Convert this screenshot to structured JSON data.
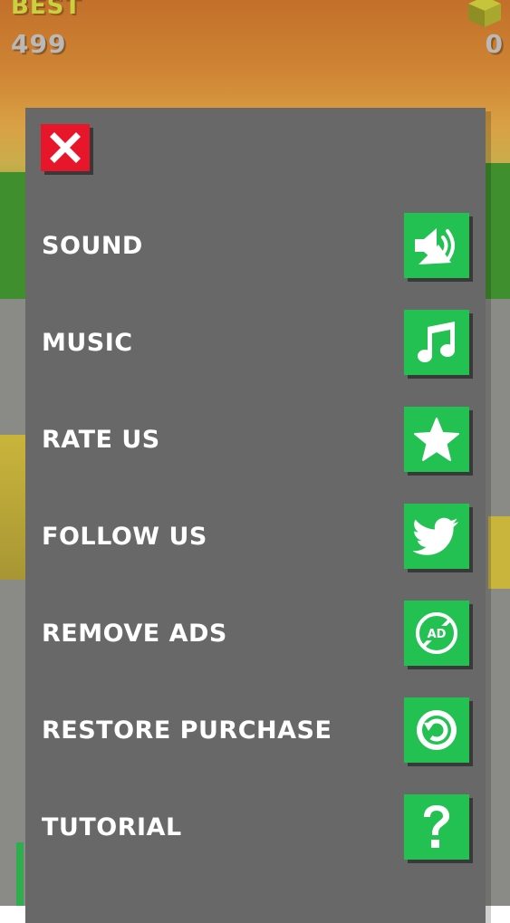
{
  "hud": {
    "best_label": "BEST",
    "best_score": "499",
    "coins": "0",
    "coin_icon": "cube-icon"
  },
  "colors": {
    "panel": "#686868",
    "button_green": "#22c151",
    "close_red": "#e8162a"
  },
  "menu": {
    "close_icon": "close-icon",
    "items": [
      {
        "label": "SOUND",
        "icon": "sound-icon"
      },
      {
        "label": "MUSIC",
        "icon": "music-note-icon"
      },
      {
        "label": "RATE US",
        "icon": "star-icon"
      },
      {
        "label": "FOLLOW US",
        "icon": "twitter-bird-icon"
      },
      {
        "label": "REMOVE ADS",
        "icon": "no-ads-icon"
      },
      {
        "label": "RESTORE PURCHASE",
        "icon": "restore-icon"
      },
      {
        "label": "TUTORIAL",
        "icon": "question-mark-icon"
      }
    ]
  }
}
